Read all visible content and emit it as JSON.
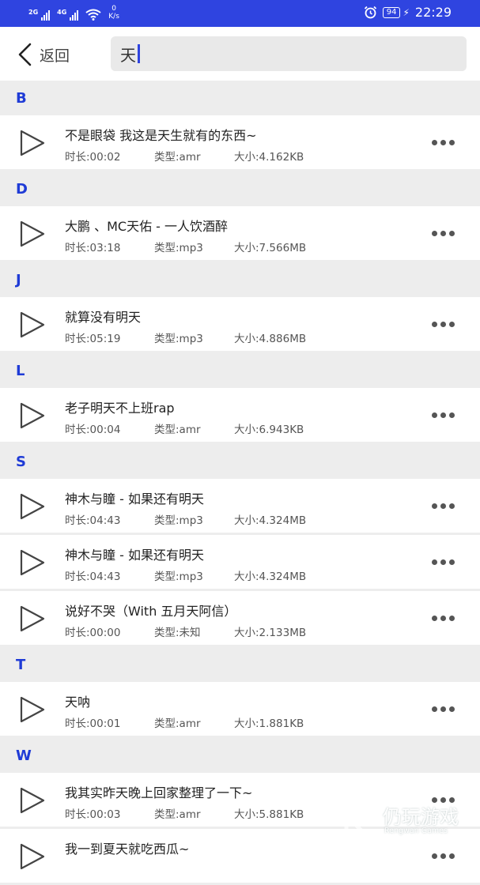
{
  "status_bar": {
    "signal1_tag": "2G",
    "signal2_tag": "4G",
    "speed_value": "0",
    "speed_unit": "K/s",
    "battery": "94",
    "time": "22:29"
  },
  "header": {
    "back_label": "返回",
    "search_value": "天"
  },
  "sections": [
    {
      "letter": "B",
      "items": [
        {
          "title": "不是眼袋 我这是天生就有的东西~",
          "duration": "时长:00:02",
          "type": "类型:amr",
          "size": "大小:4.162KB"
        }
      ]
    },
    {
      "letter": "D",
      "items": [
        {
          "title": "大鹏 、MC天佑 - 一人饮酒醉",
          "duration": "时长:03:18",
          "type": "类型:mp3",
          "size": "大小:7.566MB"
        }
      ]
    },
    {
      "letter": "J",
      "items": [
        {
          "title": "就算没有明天",
          "duration": "时长:05:19",
          "type": "类型:mp3",
          "size": "大小:4.886MB"
        }
      ]
    },
    {
      "letter": "L",
      "items": [
        {
          "title": "老子明天不上班rap",
          "duration": "时长:00:04",
          "type": "类型:amr",
          "size": "大小:6.943KB"
        }
      ]
    },
    {
      "letter": "S",
      "items": [
        {
          "title": "神木与瞳 - 如果还有明天",
          "duration": "时长:04:43",
          "type": "类型:mp3",
          "size": "大小:4.324MB"
        },
        {
          "title": "神木与瞳 - 如果还有明天",
          "duration": "时长:04:43",
          "type": "类型:mp3",
          "size": "大小:4.324MB"
        },
        {
          "title": "说好不哭（With 五月天阿信）",
          "duration": "时长:00:00",
          "type": "类型:未知",
          "size": "大小:2.133MB"
        }
      ]
    },
    {
      "letter": "T",
      "items": [
        {
          "title": "天呐",
          "duration": "时长:00:01",
          "type": "类型:amr",
          "size": "大小:1.881KB"
        }
      ]
    },
    {
      "letter": "W",
      "items": [
        {
          "title": "我其实昨天晚上回家整理了一下~",
          "duration": "时长:00:03",
          "type": "类型:amr",
          "size": "大小:5.881KB"
        },
        {
          "title": "我一到夏天就吃西瓜~",
          "duration": "",
          "type": "",
          "size": ""
        }
      ]
    }
  ],
  "watermark": {
    "text": "仍玩游戏",
    "sub": "Rengwan Games"
  },
  "colors": {
    "accent": "#2f44e0",
    "section_letter": "#1f3bd6",
    "background": "#ededed"
  }
}
